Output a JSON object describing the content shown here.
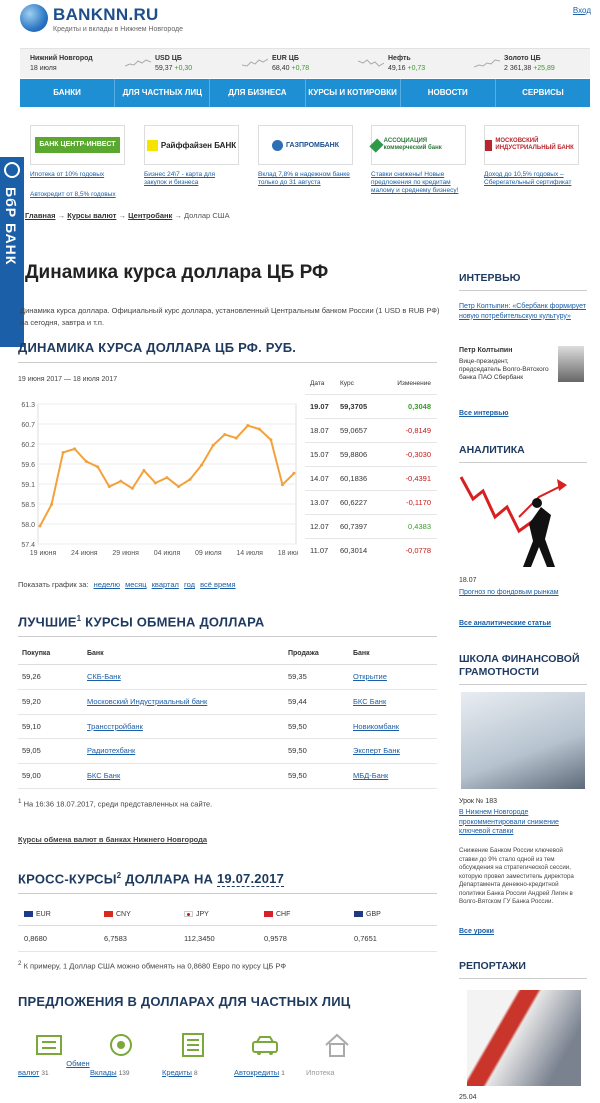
{
  "header": {
    "site_name": "BANKNN.RU",
    "tagline": "Кредиты и вклады в Нижнем Новгороде",
    "login": "Вход"
  },
  "ticker": [
    {
      "title": "Нижний Новгород",
      "value": "18 июля",
      "change": ""
    },
    {
      "title": "USD ЦБ",
      "value": "59,37",
      "change": "+0,30"
    },
    {
      "title": "EUR ЦБ",
      "value": "68,40",
      "change": "+0,78"
    },
    {
      "title": "Нефть",
      "value": "49,16",
      "change": "+0,73"
    },
    {
      "title": "Золото ЦБ",
      "value": "2 361,38",
      "change": "+25,89"
    }
  ],
  "nav": [
    "Банки",
    "Для частных лиц",
    "Для бизнеса",
    "Курсы и котировки",
    "Новости",
    "Сервисы"
  ],
  "ads": [
    {
      "logo": "БАНК ЦЕНТР-ИНВЕСТ",
      "text": "Ипотека от 10% годовых",
      "text2": "Автокредит от 8,5% годовых"
    },
    {
      "logo": "Райффайзен БАНК",
      "text": "Бизнес 24\\7 - карта для закупок и бизнеса",
      "text2": ""
    },
    {
      "logo": "ГАЗПРОМБАНК",
      "text": "Вклад 7,8% в надежном банке только до 31 августа",
      "text2": ""
    },
    {
      "logo": "АССОЦИАЦИЯ коммерческий банк",
      "text": "Ставки снижены! Новые предложения по кредитам малому и среднему бизнесу!",
      "text2": ""
    },
    {
      "logo": "МОСКОВСКИЙ ИНДУСТРИАЛЬНЫЙ БАНК",
      "text": "Доход до 10,5% годовых – Сберегательный сертификат",
      "text2": ""
    }
  ],
  "side_banner": "БбР БАНК",
  "breadcrumbs": [
    "Главная",
    "Курсы валют",
    "Центробанк",
    "Доллар США"
  ],
  "title": "Динамика курса доллара ЦБ РФ",
  "intro": "Динамика курса доллара. Официальный курс доллара, установленный Центральным банком России (1 USD в RUB РФ) на сегодня, завтра и т.п.",
  "chart_section_title": "ДИНАМИКА КУРСА ДОЛЛАРА ЦБ РФ. РУБ.",
  "chart_data": {
    "type": "line",
    "title": "19 июня 2017 — 18 июля 2017",
    "x": [
      "19.06",
      "20.06",
      "21.06",
      "22.06",
      "23.06",
      "24.06",
      "27.06",
      "28.06",
      "29.06",
      "30.06",
      "01.07",
      "04.07",
      "05.07",
      "06.07",
      "07.07",
      "08.07",
      "11.07",
      "12.07",
      "13.07",
      "14.07",
      "15.07",
      "18.07",
      "19.07"
    ],
    "values": [
      57.9,
      58.5,
      59.95,
      60.05,
      59.7,
      59.55,
      59.0,
      59.15,
      58.95,
      59.45,
      59.1,
      59.25,
      59.0,
      59.2,
      59.6,
      60.15,
      60.45,
      60.35,
      60.7,
      60.6,
      60.3,
      59.05,
      59.37
    ],
    "xticks": [
      "19 июня",
      "24 июня",
      "29 июня",
      "04 июля",
      "09 июля",
      "14 июля",
      "18 июля"
    ],
    "yticks": [
      "61.3",
      "60.7",
      "60.2",
      "59.6",
      "59.1",
      "58.5",
      "58.0",
      "57.4"
    ],
    "ylim": [
      57.4,
      61.3
    ],
    "color": "#f3a23b",
    "grid": true
  },
  "rates_table": {
    "headers": [
      "Дата",
      "Курс",
      "Изменение"
    ],
    "rows": [
      {
        "date": "19.07",
        "rate": "59,3705",
        "change": "0,3048",
        "up": true
      },
      {
        "date": "18.07",
        "rate": "59,0657",
        "change": "-0,8149",
        "up": false
      },
      {
        "date": "15.07",
        "rate": "59,8806",
        "change": "-0,3030",
        "up": false
      },
      {
        "date": "14.07",
        "rate": "60,1836",
        "change": "-0,4391",
        "up": false
      },
      {
        "date": "13.07",
        "rate": "60,6227",
        "change": "-0,1170",
        "up": false
      },
      {
        "date": "12.07",
        "rate": "60,7397",
        "change": "0,4383",
        "up": true
      },
      {
        "date": "11.07",
        "rate": "60,3014",
        "change": "-0,0778",
        "up": false
      }
    ]
  },
  "period": {
    "label": "Показать график за:",
    "links": [
      "неделю",
      "месяц",
      "квартал",
      "год",
      "всё время"
    ]
  },
  "best_title": "ЛУЧШИЕ",
  "best_title_sup": "1",
  "best_title_rest": " КУРСЫ ОБМЕНА ДОЛЛАРА",
  "best_rates": {
    "headers": [
      "Покупка",
      "Банк",
      "Продажа",
      "Банк"
    ],
    "rows": [
      [
        "59,26",
        "СКБ-Банк",
        "59,35",
        "Открытие"
      ],
      [
        "59,20",
        "Московский Индустриальный банк",
        "59,44",
        "БКС Банк"
      ],
      [
        "59,10",
        "Трансстройбанк",
        "59,50",
        "Новикомбанк"
      ],
      [
        "59,05",
        "Радиотехбанк",
        "59,50",
        "Эксперт Банк"
      ],
      [
        "59,00",
        "БКС Банк",
        "59,50",
        "МБД-Банк"
      ]
    ]
  },
  "best_note_sup": "1",
  "best_note": " На 16:36 18.07.2017, среди представленных на сайте.",
  "exchange_link": "Курсы обмена валют в банках Нижнего Новгорода",
  "cross_title": "КРОСС-КУРСЫ",
  "cross_title_sup": "2",
  "cross_title_rest": " ДОЛЛАРА НА ",
  "cross_date": "19.07.2017",
  "cross": {
    "currencies": [
      "EUR",
      "CNY",
      "JPY",
      "CHF",
      "GBP"
    ],
    "values": [
      "0,8680",
      "6,7583",
      "112,3450",
      "0,9578",
      "0,7651"
    ]
  },
  "cross_note_sup": "2",
  "cross_note": " К примеру, 1 Доллар США можно обменять на 0,8680 Евро по курсу ЦБ РФ",
  "offers_title": "ПРЕДЛОЖЕНИЯ В ДОЛЛАРАХ ДЛЯ ЧАСТНЫХ ЛИЦ",
  "offers": [
    {
      "label": "Обмен валют",
      "count": "31"
    },
    {
      "label": "Вклады",
      "count": "139"
    },
    {
      "label": "Кредиты",
      "count": "8"
    },
    {
      "label": "Автокредиты",
      "count": "1"
    },
    {
      "label": "Ипотека",
      "count": ""
    }
  ],
  "sidebar": {
    "interview_title": "ИНТЕРВЬЮ",
    "interview_link": "Петр Колтыпин: «Сбербанк формирует новую потребительскую культуру»",
    "person_name": "Петр Колтыпин",
    "person_role": "Вице-президент, председатель Волго-Вятского банка ПАО Сбербанк",
    "all_interviews": "Все интервью",
    "analytics_title": "АНАЛИТИКА",
    "analytics_date": "18.07",
    "analytics_link": "Прогноз по фондовым рынкам",
    "all_analytics": "Все аналитические статьи",
    "school_title": "ШКОЛА ФИНАНСОВОЙ ГРАМОТНОСТИ",
    "lesson_no": "Урок № 183",
    "lesson_link": "В Нижнем Новгороде прокомментировали снижение ключевой ставки",
    "lesson_text": "Снижение Банком России ключевой ставки до 9% стало одной из тем обсуждения на стратегической сессии, которую провел заместитель директора Департамента денежно-кредитной политики Банка России Андрей Лигин в Волго-Вятском ГУ Банка России.",
    "all_lessons": "Все уроки",
    "reports_title": "РЕПОРТАЖИ",
    "reports_date": "25.04"
  }
}
